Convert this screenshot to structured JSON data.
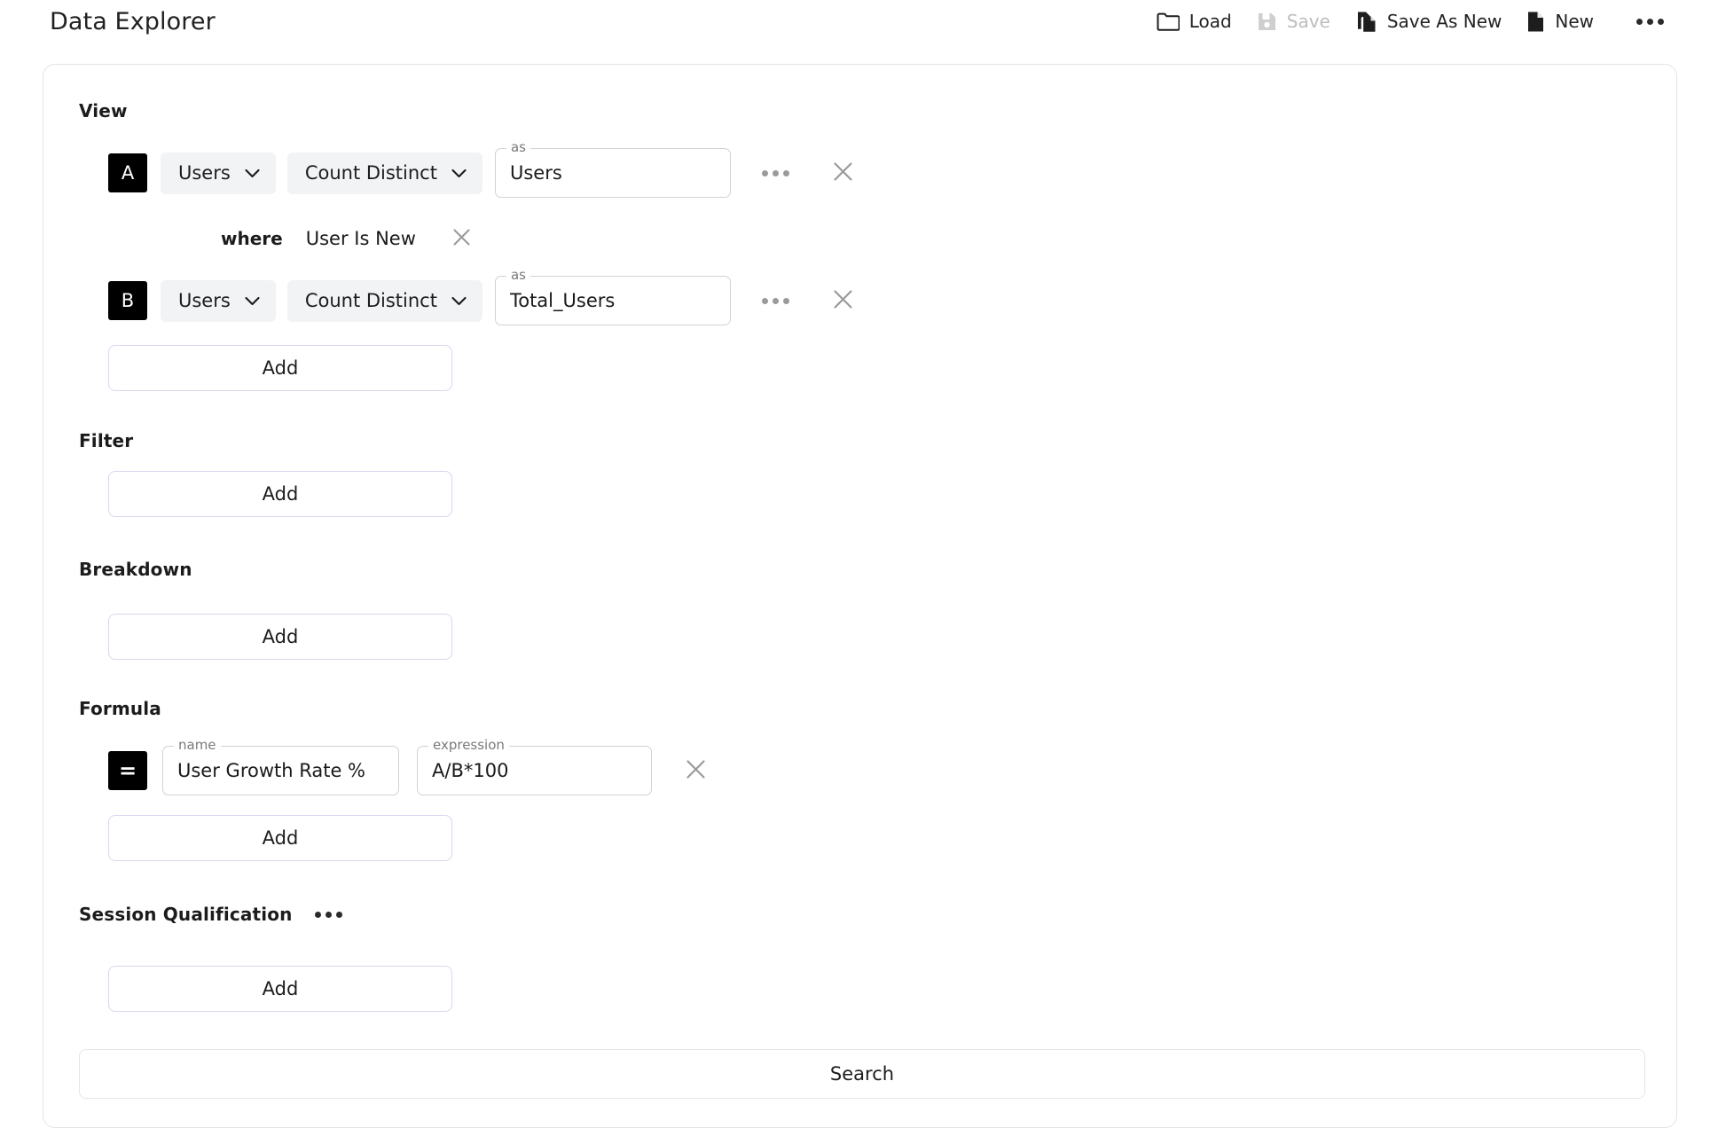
{
  "app": {
    "title": "Data Explorer"
  },
  "toolbar": {
    "load_label": "Load",
    "save_label": "Save",
    "save_as_new_label": "Save As New",
    "new_label": "New",
    "more_label": "More options",
    "icons": {
      "load": "folder-icon",
      "save": "floppy-disk-icon",
      "save_as_new": "copy-document-icon",
      "new": "document-icon",
      "more": "ellipsis-icon"
    },
    "save_disabled": true
  },
  "sections": {
    "view": {
      "label": "View",
      "rows": [
        {
          "badge": "A",
          "source": "Users",
          "aggregation": "Count Distinct",
          "as_legend": "as",
          "as_value": "Users",
          "has_where": true,
          "where_keyword": "where",
          "where_value": "User Is New"
        },
        {
          "badge": "B",
          "source": "Users",
          "aggregation": "Count Distinct",
          "as_legend": "as",
          "as_value": "Total_Users",
          "has_where": false
        }
      ],
      "add_label": "Add"
    },
    "filter": {
      "label": "Filter",
      "add_label": "Add"
    },
    "breakdown": {
      "label": "Breakdown",
      "add_label": "Add"
    },
    "formula": {
      "label": "Formula",
      "rows": [
        {
          "badge": "=",
          "name_legend": "name",
          "name_value": "User Growth Rate %",
          "expression_legend": "expression",
          "expression_value": "A/B*100"
        }
      ],
      "add_label": "Add"
    },
    "session_qualification": {
      "label": "Session Qualification",
      "menu_icon": "ellipsis-icon",
      "add_label": "Add"
    }
  },
  "footer": {
    "search_label": "Search"
  },
  "colors": {
    "badge_bg": "#000000",
    "chip_bg": "#f2f3f5",
    "add_border": "#d7d7f2",
    "card_border": "#e4e4e8",
    "muted_icon": "#9a9a9a",
    "disabled_text": "#bdbdbd",
    "text": "#1a1a1a"
  }
}
